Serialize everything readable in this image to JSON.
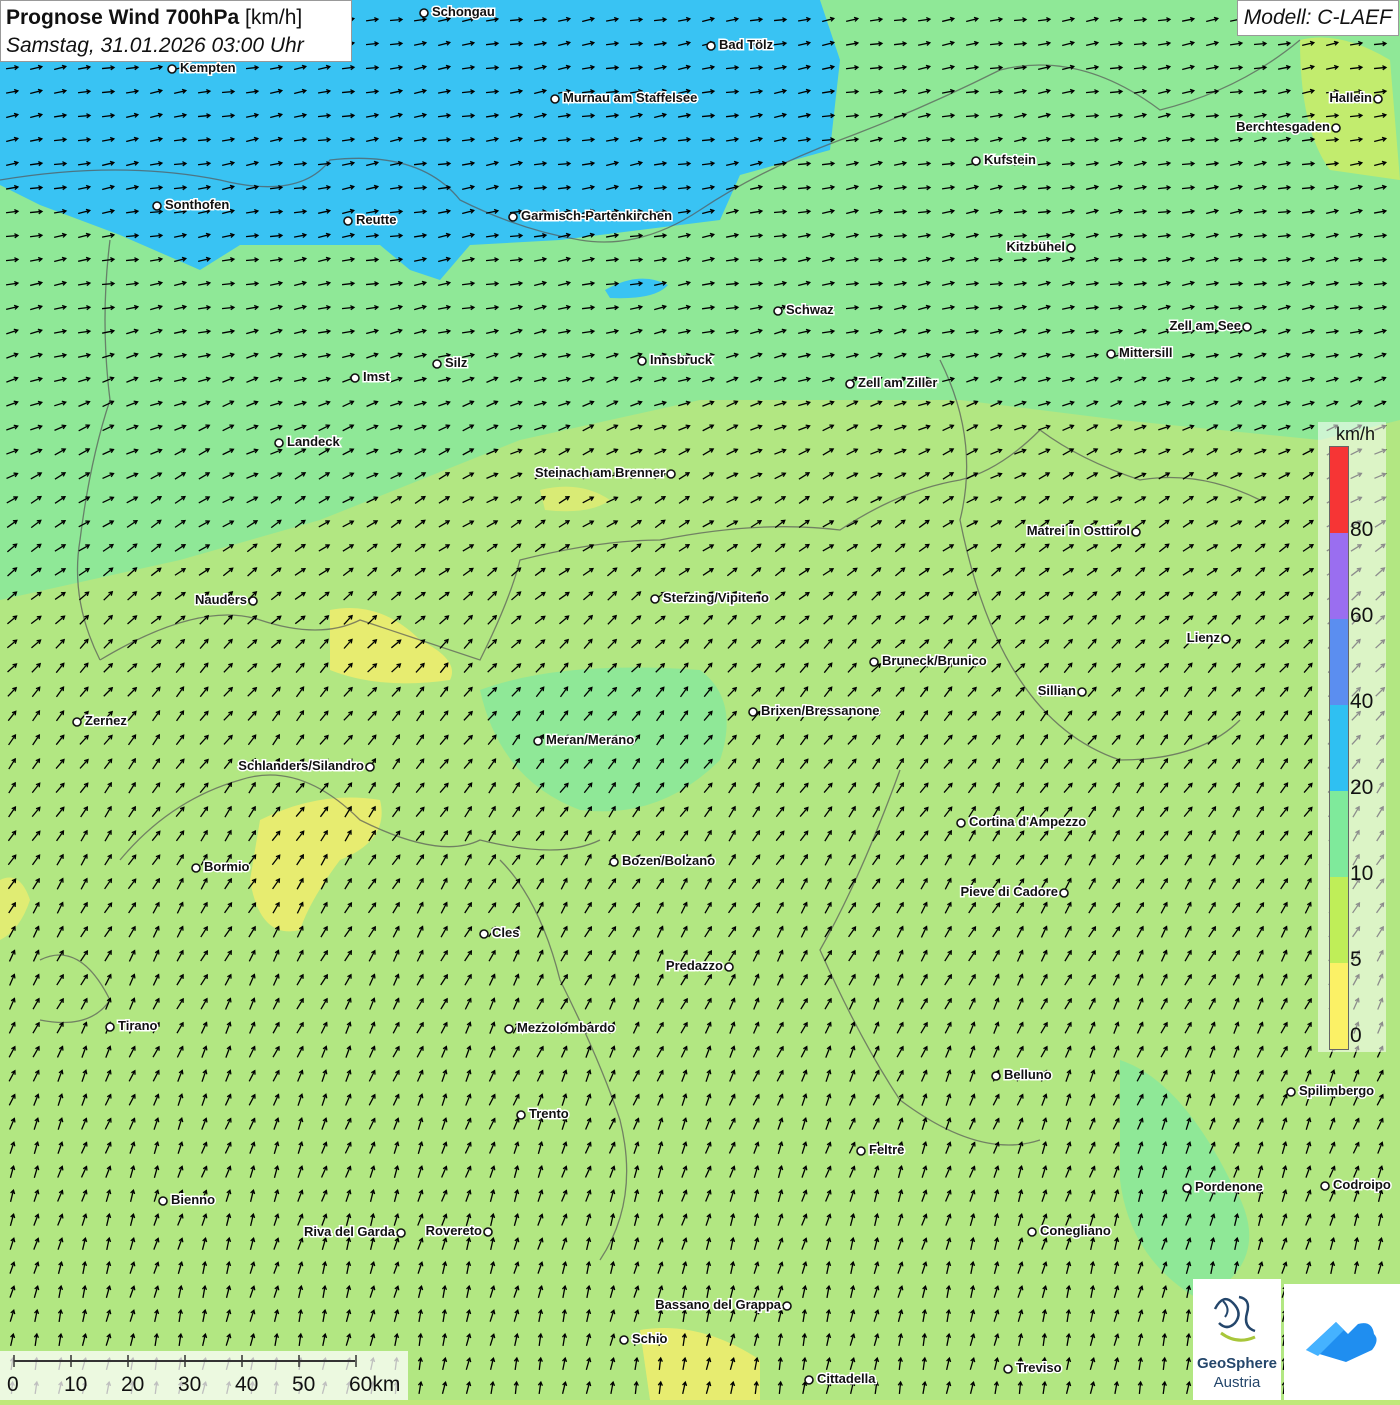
{
  "header": {
    "title_bold": "Prognose Wind 700hPa",
    "title_unit": " [km/h]",
    "subtitle": "Samstag, 31.01.2026 03:00 Uhr"
  },
  "model": "Modell: C-LAEF",
  "legend": {
    "unit": "km/h",
    "ticks": [
      "80",
      "60",
      "40",
      "20",
      "10",
      "5",
      "0"
    ],
    "colors": [
      "#f63535",
      "#9a6ef0",
      "#5b8ef0",
      "#2fc0f2",
      "#7fea9b",
      "#bfee58",
      "#fbf166"
    ]
  },
  "scale_bar": {
    "labels": [
      "0",
      "10",
      "20",
      "30",
      "40",
      "50",
      "60km"
    ]
  },
  "logos": {
    "geosphere_line1": "GeoSphere",
    "geosphere_line2": "Austria"
  },
  "field_colors": {
    "blue": "#39c3f3",
    "green": "#8fe897",
    "lightgreen": "#b2e782",
    "yellowgreen": "#c2ec6e",
    "yellow": "#f4ee6c"
  },
  "cities": [
    {
      "name": "Schongau"
    },
    {
      "name": "Bad Tölz"
    },
    {
      "name": "Kempten"
    },
    {
      "name": "Murnau am Staffelsee"
    },
    {
      "name": "Hallein"
    },
    {
      "name": "Berchtesgaden"
    },
    {
      "name": "Kufstein"
    },
    {
      "name": "Sonthofen"
    },
    {
      "name": "Reutte"
    },
    {
      "name": "Garmisch-Partenkirchen"
    },
    {
      "name": "Kitzbühel"
    },
    {
      "name": "Schwaz"
    },
    {
      "name": "Zell am See"
    },
    {
      "name": "Mittersill"
    },
    {
      "name": "Innsbruck"
    },
    {
      "name": "Silz"
    },
    {
      "name": "Imst"
    },
    {
      "name": "Zell am Ziller"
    },
    {
      "name": "Landeck"
    },
    {
      "name": "Steinach am Brenner"
    },
    {
      "name": "Matrei in Osttirol"
    },
    {
      "name": "Nauders"
    },
    {
      "name": "Sterzing/Vipiteno"
    },
    {
      "name": "Lienz"
    },
    {
      "name": "Bruneck/Brunico"
    },
    {
      "name": "Sillian"
    },
    {
      "name": "Brixen/Bressanone"
    },
    {
      "name": "Zernez"
    },
    {
      "name": "Meran/Merano"
    },
    {
      "name": "Schlanders/Silandro"
    },
    {
      "name": "Cortina d'Ampezzo"
    },
    {
      "name": "Bozen/Bolzano"
    },
    {
      "name": "Bormio"
    },
    {
      "name": "Pieve di Cadore"
    },
    {
      "name": "Cles"
    },
    {
      "name": "Predazzo"
    },
    {
      "name": "Tirano"
    },
    {
      "name": "Mezzolombardo"
    },
    {
      "name": "Belluno"
    },
    {
      "name": "Spilimbergo"
    },
    {
      "name": "Trento"
    },
    {
      "name": "Feltre"
    },
    {
      "name": "Pordenone"
    },
    {
      "name": "Codroipo"
    },
    {
      "name": "Bienno"
    },
    {
      "name": "Riva del Garda"
    },
    {
      "name": "Rovereto"
    },
    {
      "name": "Conegliano"
    },
    {
      "name": "Bassano del Grappa"
    },
    {
      "name": "Schio"
    },
    {
      "name": "Treviso"
    },
    {
      "name": "Cittadella"
    }
  ]
}
